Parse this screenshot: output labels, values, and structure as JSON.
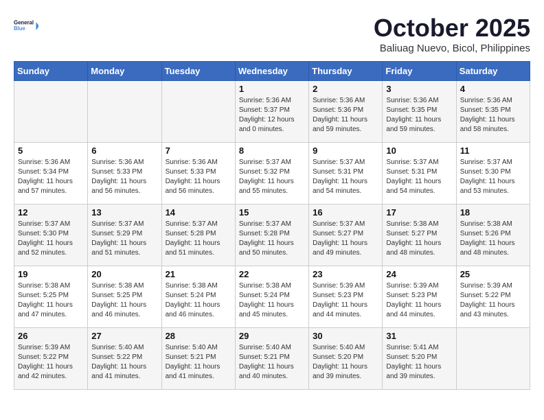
{
  "logo": {
    "line1": "General",
    "line2": "Blue"
  },
  "title": "October 2025",
  "location": "Baliuag Nuevo, Bicol, Philippines",
  "days_header": [
    "Sunday",
    "Monday",
    "Tuesday",
    "Wednesday",
    "Thursday",
    "Friday",
    "Saturday"
  ],
  "weeks": [
    [
      {
        "day": "",
        "info": ""
      },
      {
        "day": "",
        "info": ""
      },
      {
        "day": "",
        "info": ""
      },
      {
        "day": "1",
        "info": "Sunrise: 5:36 AM\nSunset: 5:37 PM\nDaylight: 12 hours\nand 0 minutes."
      },
      {
        "day": "2",
        "info": "Sunrise: 5:36 AM\nSunset: 5:36 PM\nDaylight: 11 hours\nand 59 minutes."
      },
      {
        "day": "3",
        "info": "Sunrise: 5:36 AM\nSunset: 5:35 PM\nDaylight: 11 hours\nand 59 minutes."
      },
      {
        "day": "4",
        "info": "Sunrise: 5:36 AM\nSunset: 5:35 PM\nDaylight: 11 hours\nand 58 minutes."
      }
    ],
    [
      {
        "day": "5",
        "info": "Sunrise: 5:36 AM\nSunset: 5:34 PM\nDaylight: 11 hours\nand 57 minutes."
      },
      {
        "day": "6",
        "info": "Sunrise: 5:36 AM\nSunset: 5:33 PM\nDaylight: 11 hours\nand 56 minutes."
      },
      {
        "day": "7",
        "info": "Sunrise: 5:36 AM\nSunset: 5:33 PM\nDaylight: 11 hours\nand 56 minutes."
      },
      {
        "day": "8",
        "info": "Sunrise: 5:37 AM\nSunset: 5:32 PM\nDaylight: 11 hours\nand 55 minutes."
      },
      {
        "day": "9",
        "info": "Sunrise: 5:37 AM\nSunset: 5:31 PM\nDaylight: 11 hours\nand 54 minutes."
      },
      {
        "day": "10",
        "info": "Sunrise: 5:37 AM\nSunset: 5:31 PM\nDaylight: 11 hours\nand 54 minutes."
      },
      {
        "day": "11",
        "info": "Sunrise: 5:37 AM\nSunset: 5:30 PM\nDaylight: 11 hours\nand 53 minutes."
      }
    ],
    [
      {
        "day": "12",
        "info": "Sunrise: 5:37 AM\nSunset: 5:30 PM\nDaylight: 11 hours\nand 52 minutes."
      },
      {
        "day": "13",
        "info": "Sunrise: 5:37 AM\nSunset: 5:29 PM\nDaylight: 11 hours\nand 51 minutes."
      },
      {
        "day": "14",
        "info": "Sunrise: 5:37 AM\nSunset: 5:28 PM\nDaylight: 11 hours\nand 51 minutes."
      },
      {
        "day": "15",
        "info": "Sunrise: 5:37 AM\nSunset: 5:28 PM\nDaylight: 11 hours\nand 50 minutes."
      },
      {
        "day": "16",
        "info": "Sunrise: 5:37 AM\nSunset: 5:27 PM\nDaylight: 11 hours\nand 49 minutes."
      },
      {
        "day": "17",
        "info": "Sunrise: 5:38 AM\nSunset: 5:27 PM\nDaylight: 11 hours\nand 48 minutes."
      },
      {
        "day": "18",
        "info": "Sunrise: 5:38 AM\nSunset: 5:26 PM\nDaylight: 11 hours\nand 48 minutes."
      }
    ],
    [
      {
        "day": "19",
        "info": "Sunrise: 5:38 AM\nSunset: 5:25 PM\nDaylight: 11 hours\nand 47 minutes."
      },
      {
        "day": "20",
        "info": "Sunrise: 5:38 AM\nSunset: 5:25 PM\nDaylight: 11 hours\nand 46 minutes."
      },
      {
        "day": "21",
        "info": "Sunrise: 5:38 AM\nSunset: 5:24 PM\nDaylight: 11 hours\nand 46 minutes."
      },
      {
        "day": "22",
        "info": "Sunrise: 5:38 AM\nSunset: 5:24 PM\nDaylight: 11 hours\nand 45 minutes."
      },
      {
        "day": "23",
        "info": "Sunrise: 5:39 AM\nSunset: 5:23 PM\nDaylight: 11 hours\nand 44 minutes."
      },
      {
        "day": "24",
        "info": "Sunrise: 5:39 AM\nSunset: 5:23 PM\nDaylight: 11 hours\nand 44 minutes."
      },
      {
        "day": "25",
        "info": "Sunrise: 5:39 AM\nSunset: 5:22 PM\nDaylight: 11 hours\nand 43 minutes."
      }
    ],
    [
      {
        "day": "26",
        "info": "Sunrise: 5:39 AM\nSunset: 5:22 PM\nDaylight: 11 hours\nand 42 minutes."
      },
      {
        "day": "27",
        "info": "Sunrise: 5:40 AM\nSunset: 5:22 PM\nDaylight: 11 hours\nand 41 minutes."
      },
      {
        "day": "28",
        "info": "Sunrise: 5:40 AM\nSunset: 5:21 PM\nDaylight: 11 hours\nand 41 minutes."
      },
      {
        "day": "29",
        "info": "Sunrise: 5:40 AM\nSunset: 5:21 PM\nDaylight: 11 hours\nand 40 minutes."
      },
      {
        "day": "30",
        "info": "Sunrise: 5:40 AM\nSunset: 5:20 PM\nDaylight: 11 hours\nand 39 minutes."
      },
      {
        "day": "31",
        "info": "Sunrise: 5:41 AM\nSunset: 5:20 PM\nDaylight: 11 hours\nand 39 minutes."
      },
      {
        "day": "",
        "info": ""
      }
    ]
  ]
}
